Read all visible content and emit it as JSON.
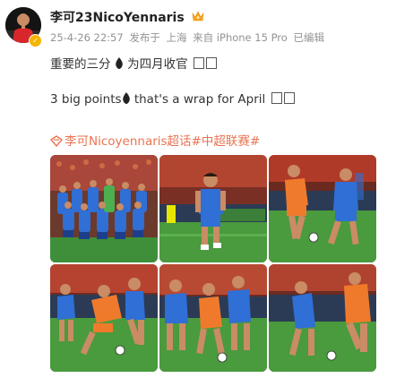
{
  "user": {
    "name": "李可23NicoYennaris",
    "avatar_icon": "player-avatar",
    "badge_icon": "crown-icon",
    "verified_icon": "verified-badge-icon"
  },
  "meta": {
    "time": "25-4-26 22:57",
    "published_label": "发布于",
    "location": "上海",
    "source": "来自 iPhone 15 Pro",
    "edited": "已编辑"
  },
  "content": {
    "line1_text": "重要的三分",
    "line1_tail": "为四月收官",
    "line2_text": "3 big points",
    "line2_tail": "that's a wrap for April",
    "drop_icon": "fire-drop-icon",
    "topic": "李可Nicoyennaris超话#中超联赛#",
    "topic_icon": "super-topic-icon"
  },
  "photos": [
    {
      "alt": "team-lineup-photo",
      "accent": "#2f6fd6"
    },
    {
      "alt": "player-walking-photo",
      "accent": "#2f6fd6"
    },
    {
      "alt": "duel-orange-blue-photo",
      "accent": "#f07a2b"
    },
    {
      "alt": "tackle-photo",
      "accent": "#f07a2b"
    },
    {
      "alt": "group-challenge-photo",
      "accent": "#2f6fd6"
    },
    {
      "alt": "dribble-photo",
      "accent": "#f07a2b"
    }
  ],
  "colors": {
    "topic": "#eb7350",
    "meta": "#939393",
    "pitch": "#3f8f3a",
    "home_kit": "#2f6fd6",
    "away_kit": "#f07a2b"
  }
}
